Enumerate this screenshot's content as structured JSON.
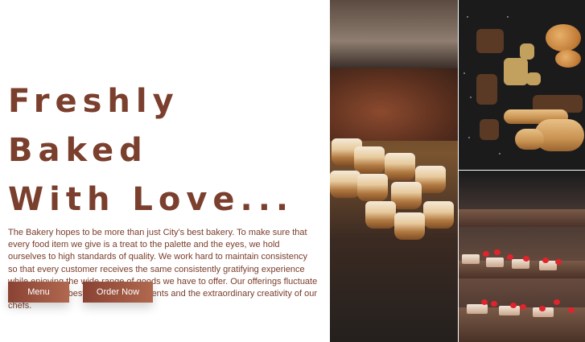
{
  "hero": {
    "headline_line1": "Freshly Baked",
    "headline_line2": "With Love...",
    "description": "The Bakery hopes to be more than just City's best bakery. To make sure that every food item we give is a treat to the palette and the eyes, we hold ourselves to high standards of quality. We work hard to maintain consistency so that every customer receives the same consistently gratifying experience while enjoying the wide range of goods we have to offer. Our offerings fluctuate to highlight the best seasonal ingredients and the extraordinary creativity of our chefs."
  },
  "buttons": {
    "menu_label": "Menu",
    "order_label": "Order Now"
  },
  "colors": {
    "accent": "#7b3f2e",
    "button_gradient_start": "#8a4333",
    "button_gradient_end": "#b0684f"
  }
}
